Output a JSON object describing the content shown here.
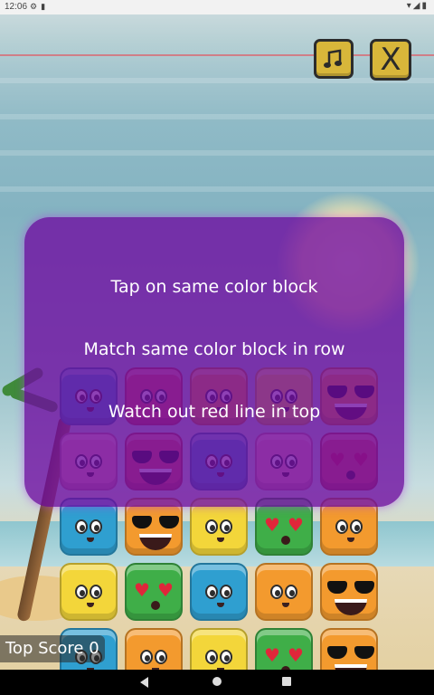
{
  "status_bar": {
    "time": "12:06",
    "left_icons": [
      "settings-icon",
      "sd-card-icon"
    ],
    "right_icons": [
      "wifi-icon",
      "signal-icon",
      "battery-icon"
    ]
  },
  "header": {
    "music_button": "music-note-icon",
    "close_button_glyph": "X"
  },
  "overlay": {
    "lines": [
      "Tap on same color block",
      "Match same color block in row",
      "Watch out red line in top"
    ]
  },
  "score": {
    "top_score_label": "Top Score 0"
  },
  "board": {
    "colors": {
      "blue": "#2f9fd0",
      "red": "#e25a56",
      "yellow": "#f3d63a",
      "orange": "#f39a2e",
      "green": "#3fae48",
      "pink": "#f4a7b4"
    },
    "rows": [
      [
        {
          "color": "blue",
          "face": "eyes"
        },
        {
          "color": "red",
          "face": "eyes"
        },
        {
          "color": "orange",
          "face": "eyes"
        },
        {
          "color": "yellow",
          "face": "eyes"
        },
        {
          "color": "orange",
          "face": "cool"
        }
      ],
      [
        {
          "color": "pink",
          "face": "eyes"
        },
        {
          "color": "red",
          "face": "cool"
        },
        {
          "color": "blue",
          "face": "eyes"
        },
        {
          "color": "pink",
          "face": "eyes"
        },
        {
          "color": "red",
          "face": "love"
        }
      ],
      [
        {
          "color": "blue",
          "face": "eyes"
        },
        {
          "color": "orange",
          "face": "cool"
        },
        {
          "color": "yellow",
          "face": "eyes"
        },
        {
          "color": "green",
          "face": "love"
        },
        {
          "color": "orange",
          "face": "eyes"
        }
      ],
      [
        {
          "color": "yellow",
          "face": "eyes"
        },
        {
          "color": "green",
          "face": "love"
        },
        {
          "color": "blue",
          "face": "eyes"
        },
        {
          "color": "orange",
          "face": "eyes"
        },
        {
          "color": "orange",
          "face": "cool"
        }
      ],
      [
        {
          "color": "blue",
          "face": "eyes"
        },
        {
          "color": "orange",
          "face": "eyes"
        },
        {
          "color": "yellow",
          "face": "eyes"
        },
        {
          "color": "green",
          "face": "love"
        },
        {
          "color": "orange",
          "face": "cool"
        }
      ]
    ]
  },
  "nav_bar": {
    "icons": [
      "back-icon",
      "home-icon",
      "recents-icon"
    ]
  }
}
